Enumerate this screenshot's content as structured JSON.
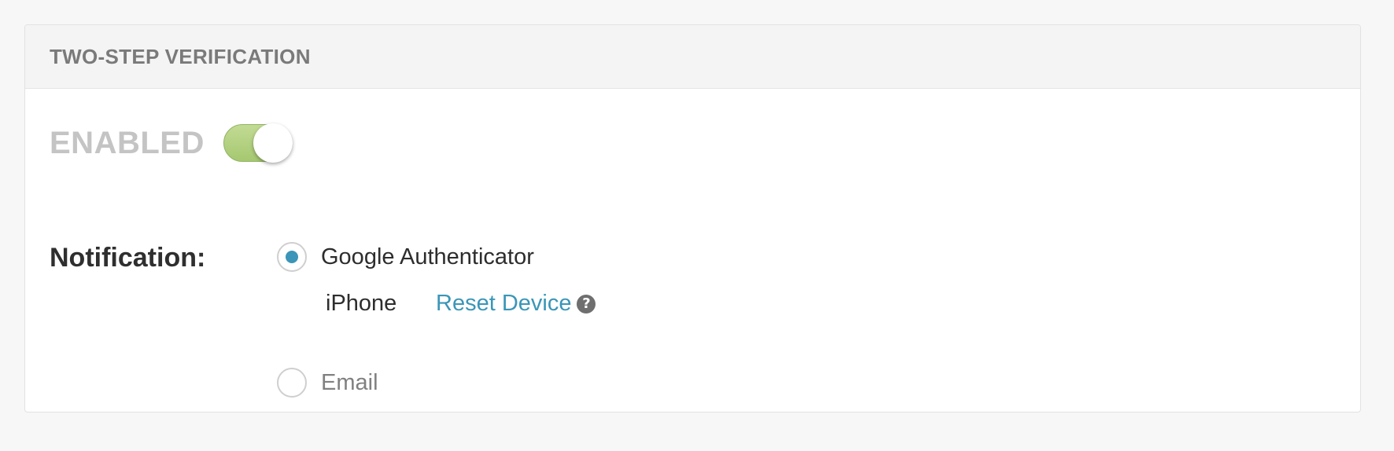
{
  "card": {
    "title": "TWO-STEP VERIFICATION"
  },
  "status": {
    "label": "ENABLED",
    "toggle_on": true,
    "toggle_color": "#a6c870"
  },
  "notification": {
    "label": "Notification:",
    "options": [
      {
        "label": "Google Authenticator",
        "selected": true,
        "device": {
          "name": "iPhone",
          "reset_label": "Reset Device",
          "help_icon": "question-circle-icon"
        }
      },
      {
        "label": "Email",
        "selected": false
      }
    ]
  },
  "colors": {
    "accent": "#3a96b7",
    "radio_selected": "#3b95b8"
  }
}
